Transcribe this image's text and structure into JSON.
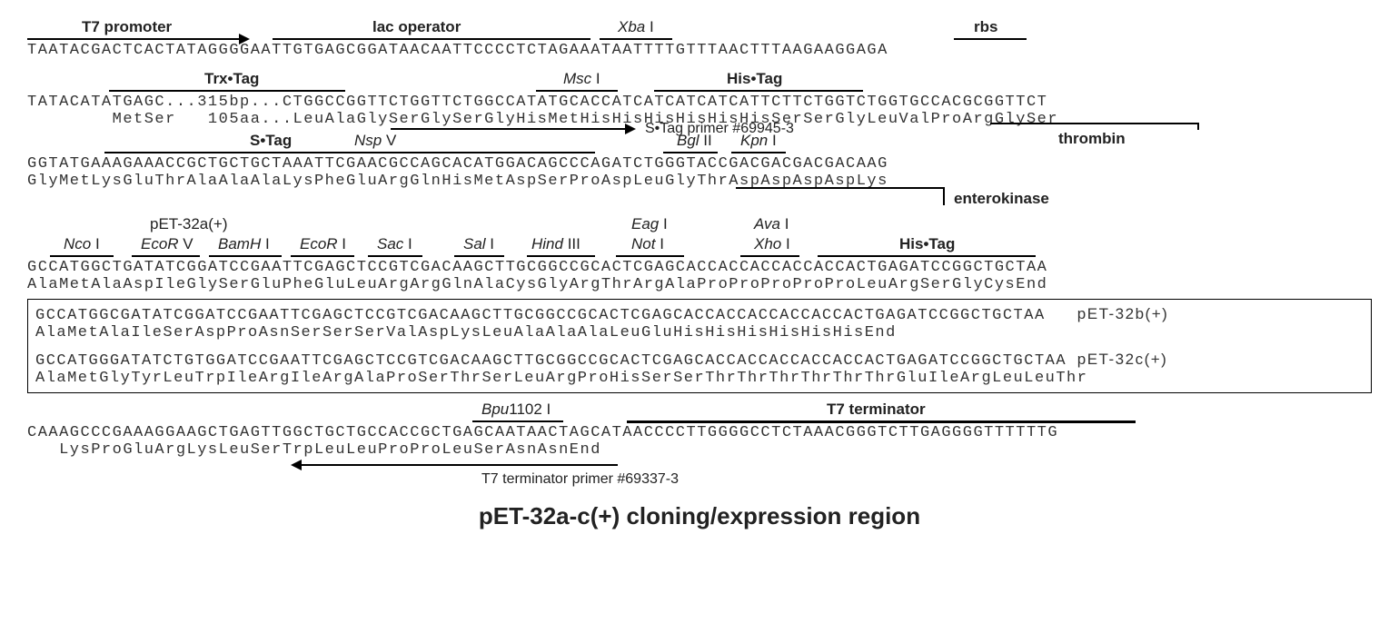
{
  "title": "pET-32a-c(+) cloning/expression region",
  "labels": {
    "t7promoter": "T7 promoter",
    "lacop": "lac operator",
    "xba": "Xba",
    "rbs": "rbs",
    "trxtag": "Trx•Tag",
    "msc": "Msc",
    "histag": "His•Tag",
    "stag_primer": "S•Tag primer #69945-3",
    "stag": "S•Tag",
    "nsp": "Nsp",
    "bgl": "Bgl",
    "kpn": "Kpn",
    "thrombin": "thrombin",
    "enterokinase": "enterokinase",
    "pet32a": "pET-32a(+)",
    "pet32b": "pET-32b(+)",
    "pet32c": "pET-32c(+)",
    "nco": "Nco",
    "ecorv": "EcoR",
    "bamh": "BamH",
    "ecor": "EcoR",
    "sac": "Sac",
    "sal": "Sal",
    "hind": "Hind",
    "eag": "Eag",
    "not": "Not",
    "ava": "Ava",
    "xho": "Xho",
    "bpu": "Bpu",
    "t7term": "T7 terminator",
    "t7term_primer": "T7 terminator primer #69337-3",
    "I": " I",
    "II": " II",
    "III": " III",
    "V": " V",
    "n1102": "1102"
  },
  "seq": {
    "r1": "TAATACGACTCACTATAGGGGAATTGTGAGCGGATAACAATTCCCCTCTAGAAATAATTTTGTTTAACTTTAAGAAGGAGA",
    "r2dna": "TATACATATGAGC...315bp...CTGGCCGGTTCTGGTTCTGGCCATATGCACCATCATCATCATCATTCTTCTGGTCTGGTGCCACGCGGTTCT",
    "r2aa": "        MetSer   105aa...LeuAlaGlySerGlySerGlyHisMetHisHisHisHisHisHisSerSerGlyLeuValProArgGlySer",
    "r3dna": "GGTATGAAAGAAACCGCTGCTGCTAAATTCGAACGCCAGCACATGGACAGCCCAGATCTGGGTACCGACGACGACGACAAG",
    "r3aa": "GlyMetLysGluThrAlaAlaAlaLysPheGluArgGlnHisMetAspSerProAspLeuGlyThrAspAspAspAspLys",
    "r4dna": "GCCATGGCTGATATCGGATCCGAATTCGAGCTCCGTCGACAAGCTTGCGGCCGCACTCGAGCACCACCACCACCACCACTGAGATCCGGCTGCTAA",
    "r4aa": "AlaMetAlaAspIleGlySerGluPheGluLeuArgArgGlnAlaCysGlyArgThrArgAlaProProProProProLeuArgSerGlyCysEnd",
    "r5dna": "GCCATGGCGATATCGGATCCGAATTCGAGCTCCGTCGACAAGCTTGCGGCCGCACTCGAGCACCACCACCACCACCACTGAGATCCGGCTGCTAA",
    "r5aa": "AlaMetAlaIleSerAspProAsnSerSerSerValAspLysLeuAlaAlaAlaLeuGluHisHisHisHisHisHisEnd",
    "r6dna": "GCCATGGGATATCTGTGGATCCGAATTCGAGCTCCGTCGACAAGCTTGCGGCCGCACTCGAGCACCACCACCACCACCACTGAGATCCGGCTGCTAA",
    "r6aa": "AlaMetGlyTyrLeuTrpIleArgIleArgAlaProSerThrSerLeuArgProHisSerSerThrThrThrThrThrThrGluIleArgLeuLeuThr",
    "r7dna": "CAAAGCCCGAAAGGAAGCTGAGTTGGCTGCTGCCACCGCTGAGCAATAACTAGCATAACCCCTTGGGGCCTCTAAACGGGTCTTGAGGGGTTTTTTG",
    "r7aa": "   LysProGluArgLysLeuSerTrpLeuLeuProProLeuSerAsnAsnEnd"
  }
}
